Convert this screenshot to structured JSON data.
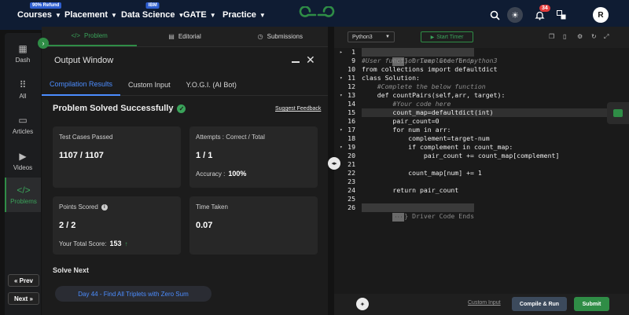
{
  "navbar": {
    "courses": {
      "label": "Courses",
      "badge": "90% Refund"
    },
    "placement": {
      "label": "Placement"
    },
    "datascience": {
      "label": "Data Science",
      "badge": "IBM"
    },
    "gate": {
      "label": "GATE"
    },
    "practice": {
      "label": "Practice"
    },
    "notification_count": "34",
    "avatar_initial": "R",
    "icons": [
      "search-icon",
      "theme-toggle-icon",
      "bell-icon",
      "translate-icon"
    ],
    "colors": {
      "bg": "#0f1c33",
      "logo": "#2f8d46"
    }
  },
  "rail": {
    "items": [
      {
        "label": "Dash",
        "icon": "grid-icon"
      },
      {
        "label": "All",
        "icon": "apps-icon"
      },
      {
        "label": "Articles",
        "icon": "book-icon"
      },
      {
        "label": "Videos",
        "icon": "play-icon"
      },
      {
        "label": "Problems",
        "icon": "code-icon"
      }
    ],
    "prev_label": "« Prev",
    "next_label": "Next »"
  },
  "problem_tabs": [
    {
      "label": "Problem",
      "icon": "</>"
    },
    {
      "label": "Editorial",
      "icon": "▤"
    },
    {
      "label": "Submissions",
      "icon": "◷"
    }
  ],
  "output": {
    "title": "Output Window",
    "tabs": [
      "Compilation Results",
      "Custom Input",
      "Y.O.G.I. (AI Bot)"
    ],
    "status": "Problem Solved Successfully",
    "feedback_link": "Suggest Feedback",
    "cards": {
      "tests": {
        "label": "Test Cases Passed",
        "value": "1107 / 1107"
      },
      "attempts": {
        "label": "Attempts : Correct / Total",
        "value": "1 / 1",
        "sub_label": "Accuracy :",
        "sub_value": "100%"
      },
      "points": {
        "label": "Points Scored",
        "value": "2 / 2",
        "sub_label": "Your Total Score:",
        "sub_value": "153"
      },
      "time": {
        "label": "Time Taken",
        "value": "0.07"
      }
    },
    "solve_next": {
      "heading": "Solve Next",
      "link": "Day 44 - Find All Triplets with Zero Sum"
    }
  },
  "editor": {
    "language": "Python3",
    "timer_label": "Start Timer",
    "fold_top": "} Driver Code Ends",
    "fold_bottom": "} Driver Code Ends",
    "code_lines": [
      {
        "n": "9",
        "text": "#User function Template for python3",
        "cls": "cm"
      },
      {
        "n": "10",
        "text": "from collections import defaultdict",
        "cls": ""
      },
      {
        "n": "11",
        "text": "class Solution:",
        "cls": "",
        "fold": true
      },
      {
        "n": "12",
        "text": "    #Complete the below function",
        "cls": "cm"
      },
      {
        "n": "13",
        "text": "    def countPairs(self,arr, target):",
        "cls": "",
        "fold": true
      },
      {
        "n": "14",
        "text": "        #Your code here",
        "cls": "cm"
      },
      {
        "n": "15",
        "text": "        count_map=defaultdict(int)",
        "cls": "",
        "hl": true
      },
      {
        "n": "16",
        "text": "        pair_count=0",
        "cls": ""
      },
      {
        "n": "17",
        "text": "        for num in arr:",
        "cls": "",
        "fold": true
      },
      {
        "n": "18",
        "text": "            complement=target-num",
        "cls": ""
      },
      {
        "n": "19",
        "text": "            if complement in count_map:",
        "cls": "",
        "fold": true
      },
      {
        "n": "20",
        "text": "                pair_count += count_map[complement]",
        "cls": ""
      },
      {
        "n": "21",
        "text": "",
        "cls": ""
      },
      {
        "n": "22",
        "text": "            count_map[num] += 1",
        "cls": ""
      },
      {
        "n": "23",
        "text": "",
        "cls": ""
      },
      {
        "n": "24",
        "text": "        return pair_count",
        "cls": ""
      },
      {
        "n": "25",
        "text": "",
        "cls": ""
      }
    ],
    "first_line_number": "1",
    "last_line_number": "26",
    "custom_input_label": "Custom Input",
    "compile_label": "Compile & Run",
    "submit_label": "Submit"
  }
}
